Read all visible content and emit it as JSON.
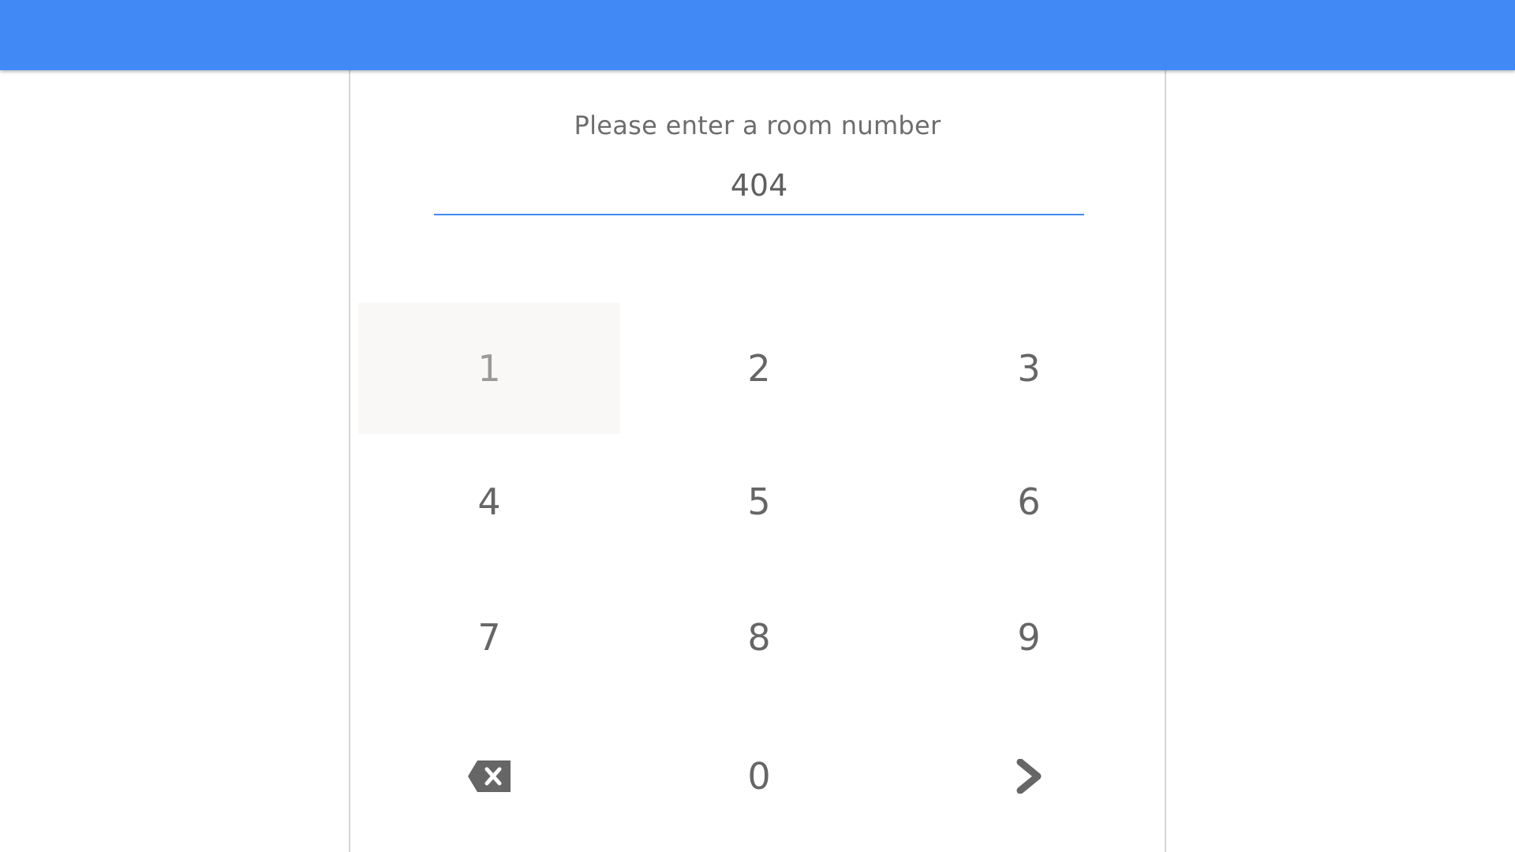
{
  "header": {
    "color": "#418af6"
  },
  "prompt": "Please enter a room number",
  "room_input": {
    "value": "404"
  },
  "keypad": {
    "keys": [
      "1",
      "2",
      "3",
      "4",
      "5",
      "6",
      "7",
      "8",
      "9",
      "0"
    ],
    "backspace_icon": "backspace-icon",
    "submit_icon": "chevron-right-icon",
    "hovered_key": "1"
  }
}
